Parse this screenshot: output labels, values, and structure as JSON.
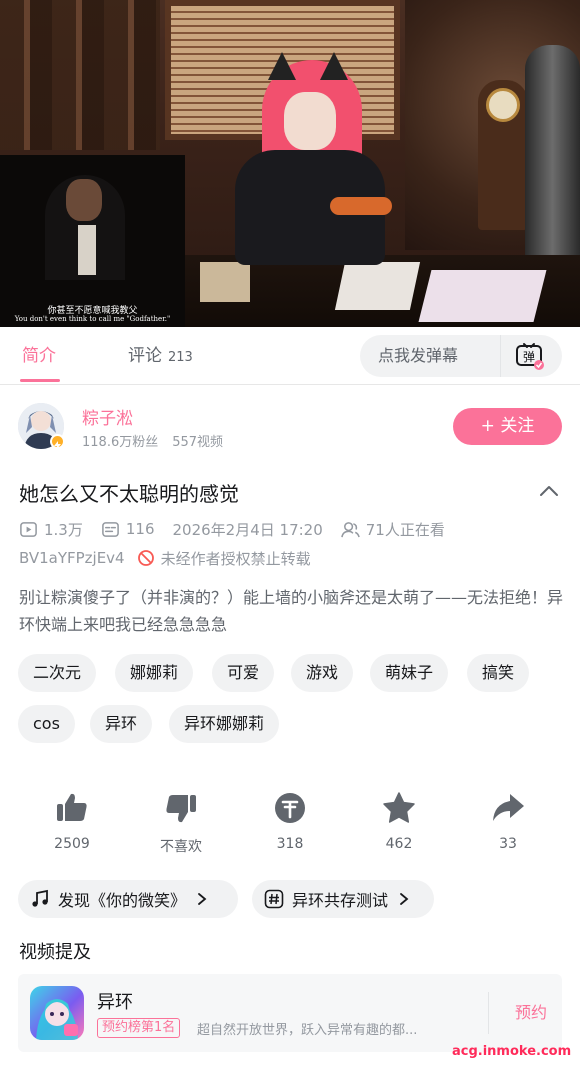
{
  "player": {
    "subtitle_cn": "你甚至不愿意喊我教父",
    "subtitle_en": "You don't even think to call me \"Godfather.\""
  },
  "tabs": {
    "intro_label": "简介",
    "comments_label": "评论",
    "comments_count": "213",
    "danmaku_placeholder": "点我发弹幕",
    "danmaku_button_label": "弹"
  },
  "uploader": {
    "name": "粽子淞",
    "followers": "118.6万粉丝",
    "videos": "557视频",
    "follow_label": "+ 关注"
  },
  "video": {
    "title": "她怎么又不太聪明的感觉",
    "views": "1.3万",
    "danmaku_count": "116",
    "publish_time": "2026年2月4日 17:20",
    "watching_now": "71人正在看",
    "bvid": "BV1aYFPzjEv4",
    "repost_notice": "未经作者授权禁止转载",
    "description": "别让粽演傻子了（并非演的？）能上墙的小脑斧还是太萌了——无法拒绝！异环快端上来吧我已经急急急急"
  },
  "tags": [
    "二次元",
    "娜娜莉",
    "可爱",
    "游戏",
    "萌妹子",
    "搞笑",
    "cos",
    "异环",
    "异环娜娜莉"
  ],
  "actions": {
    "like": "2509",
    "dislike": "不喜欢",
    "coin": "318",
    "favorite": "462",
    "share": "33"
  },
  "chips": {
    "music": "发现《你的微笑》",
    "topic": "异环共存测试"
  },
  "mentions": {
    "section_title": "视频提及",
    "game_name": "异环",
    "rank_badge": "预约榜第1名",
    "game_desc": "超自然开放世界，跃入异常有趣的都...",
    "reserve_label": "预约"
  },
  "watermark": "acg.inmoke.com",
  "colors": {
    "accent": "#fb7299",
    "text_primary": "#18191c",
    "text_secondary": "#61666d",
    "text_muted": "#9499a0",
    "chip_bg": "#f1f2f3"
  }
}
